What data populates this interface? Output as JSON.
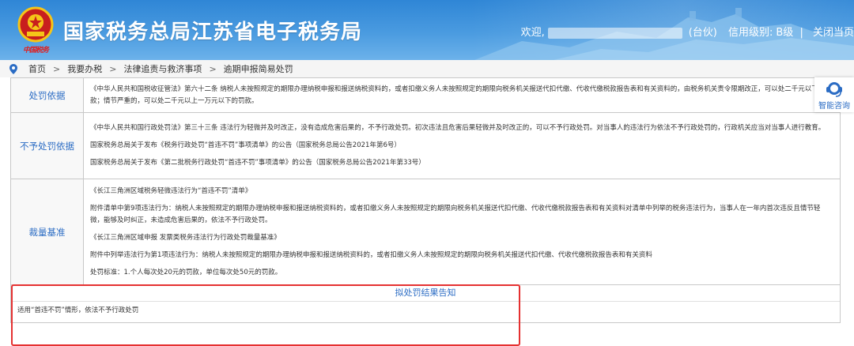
{
  "header": {
    "title": "国家税务总局江苏省电子税务局",
    "logo_text": "中国税务",
    "welcome": "欢迎,",
    "suffix": "(台伙)",
    "credit_label": "信用级别:",
    "credit_value": "B级",
    "separator": "|",
    "close_label": "关闭当页"
  },
  "breadcrumb": {
    "items": [
      "首页",
      "我要办税",
      "法律追责与救济事项",
      "逾期申报简易处罚"
    ],
    "separator": ">"
  },
  "rows": [
    {
      "label": "处罚依据",
      "paragraphs": [
        "《中华人民共和国税收征管法》第六十二条 纳税人未按照规定的期限办理纳税申报和报送纳税资料的，或者扣缴义务人未按照规定的期限向税务机关报送代扣代缴、代收代缴税款报告表和有关资料的，由税务机关责令限期改正，可以处二千元以下的罚款；情节严重的，可以处二千元以上一万元以下的罚款。"
      ]
    },
    {
      "label": "不予处罚依据",
      "paragraphs": [
        "《中华人民共和国行政处罚法》第三十三条 违法行为轻微并及时改正，没有造成危害后果的，不予行政处罚。初次违法且危害后果轻微并及时改正的，可以不予行政处罚。对当事人的违法行为依法不予行政处罚的，行政机关应当对当事人进行教育。",
        "国家税务总局关于发布《税务行政处罚“首违不罚”事项清单》的公告（国家税务总局公告2021年第6号）",
        "国家税务总局关于发布《第二批税务行政处罚“首违不罚”事项清单》的公告（国家税务总局公告2021年第33号）"
      ]
    },
    {
      "label": "裁量基准",
      "paragraphs": [
        "《长江三角洲区域税务轻微违法行为“首违不罚”清单》",
        "附件清单中第9项违法行为：纳税人未按照规定的期限办理纳税申报和报送纳税资料的，或者扣缴义务人未按照规定的期限向税务机关报送代扣代缴、代收代缴税款报告表和有关资料对清单中列举的税务违法行为，当事人在一年内首次违反且情节轻微，能够及时纠正，未造成危害后果的，依法不予行政处罚。",
        "《长江三角洲区域申报 发票类税务违法行为行政处罚裁量基准》",
        "附件中列举违法行为第1项违法行为：纳税人未按照规定的期限办理纳税申报和报送纳税资料的，或者扣缴义务人未按照规定的期限向税务机关报送代扣代缴、代收代缴税款报告表和有关资料",
        "处罚标准：1.个人每次处20元的罚款，单位每次处50元的罚款。"
      ]
    }
  ],
  "notice": {
    "title": "拟处罚结果告知",
    "body": "适用“首违不罚”情形，依法不予行政处罚"
  },
  "side_widget": {
    "label": "智能咨询",
    "icon": "customer-service-icon"
  },
  "colors": {
    "header_blue": "#3a8fdb",
    "label_blue": "#2b6cc4",
    "highlight_red": "#e53131"
  }
}
